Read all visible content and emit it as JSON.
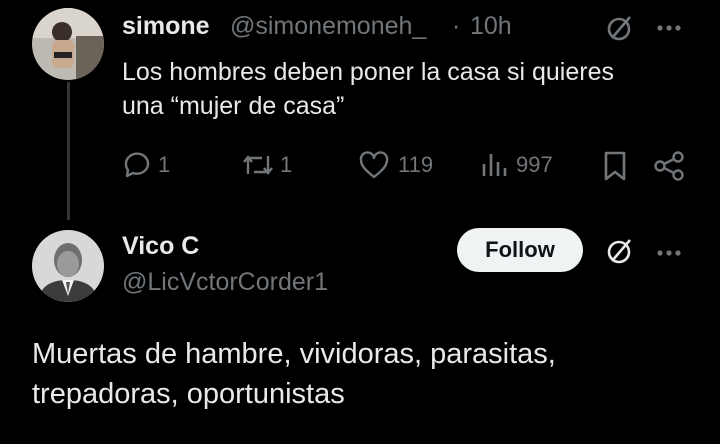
{
  "tweet1": {
    "display_name": "simone",
    "handle": "@simonemoneh_",
    "separator": "·",
    "time": "10h",
    "text_line1": "Los hombres deben poner la casa si quieres",
    "text_line2": "una “mujer de casa”",
    "actions": {
      "replies": "1",
      "reposts": "1",
      "likes": "119",
      "views": "997"
    }
  },
  "tweet2": {
    "display_name": "Vico C",
    "handle": "@LicVctorCorder1",
    "follow_label": "Follow",
    "text_line1": "Muertas de hambre, vividoras, parasitas,",
    "text_line2": "trepadoras, oportunistas"
  },
  "colors": {
    "background": "#000000",
    "text": "#e7e9ea",
    "muted": "#71767b",
    "follow_bg": "#eff3f4"
  }
}
